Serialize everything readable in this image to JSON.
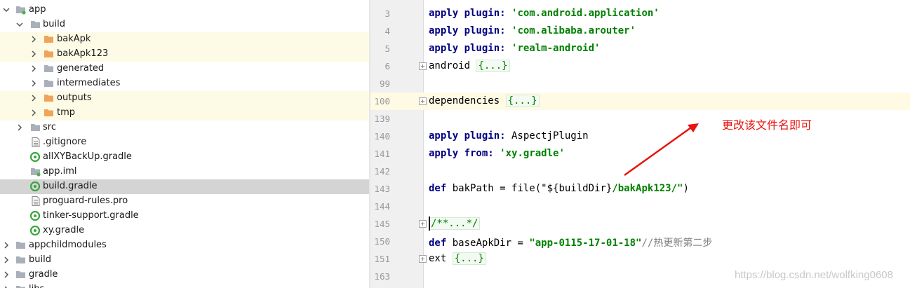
{
  "project_tree": {
    "items": [
      {
        "label": "app",
        "type": "module",
        "expanded": true
      },
      {
        "label": "build",
        "type": "folder",
        "expanded": true
      },
      {
        "label": "bakApk",
        "type": "folder-orange",
        "expanded": false
      },
      {
        "label": "bakApk123",
        "type": "folder-orange",
        "expanded": false
      },
      {
        "label": "generated",
        "type": "folder",
        "expanded": false
      },
      {
        "label": "intermediates",
        "type": "folder",
        "expanded": false
      },
      {
        "label": "outputs",
        "type": "folder-orange",
        "expanded": false
      },
      {
        "label": "tmp",
        "type": "folder-orange",
        "expanded": false
      },
      {
        "label": "src",
        "type": "folder",
        "expanded": false
      },
      {
        "label": ".gitignore",
        "type": "file"
      },
      {
        "label": "allXYBackUp.gradle",
        "type": "gradle"
      },
      {
        "label": "app.iml",
        "type": "iml"
      },
      {
        "label": "build.gradle",
        "type": "gradle",
        "selected": true
      },
      {
        "label": "proguard-rules.pro",
        "type": "file"
      },
      {
        "label": "tinker-support.gradle",
        "type": "gradle"
      },
      {
        "label": "xy.gradle",
        "type": "gradle"
      },
      {
        "label": "appchildmodules",
        "type": "folder",
        "expanded": false
      },
      {
        "label": "build",
        "type": "folder",
        "expanded": false
      },
      {
        "label": "gradle",
        "type": "folder",
        "expanded": false
      },
      {
        "label": "libs",
        "type": "folder",
        "expanded": false
      }
    ]
  },
  "editor": {
    "lines": [
      {
        "num": "3",
        "kw": "apply plugin:",
        "rest": " ",
        "str": "'com.android.application'"
      },
      {
        "num": "4",
        "kw": "apply plugin:",
        "rest": " ",
        "str": "'com.alibaba.arouter'"
      },
      {
        "num": "5",
        "kw": "apply plugin:",
        "rest": " ",
        "str": "'realm-android'"
      },
      {
        "num": "6",
        "plain": "android ",
        "folded": "{...}"
      },
      {
        "num": "99"
      },
      {
        "num": "100",
        "plain": "dependencies ",
        "folded": "{...}"
      },
      {
        "num": "139"
      },
      {
        "num": "140",
        "kw": "apply plugin:",
        "rest": " AspectjPlugin"
      },
      {
        "num": "141",
        "kw": "apply from:",
        "rest": " ",
        "str": "'xy.gradle'"
      },
      {
        "num": "142"
      },
      {
        "num": "143",
        "kw": "def",
        "rest": " bakPath = file(\"${buildDir}",
        "str": "/bakApk123/\"",
        "tail": ")"
      },
      {
        "num": "144"
      },
      {
        "num": "145",
        "folded": "/**...*/"
      },
      {
        "num": "150",
        "kw": "def",
        "rest": " baseApkDir = ",
        "str": "\"app-0115-17-01-18\"",
        "comment": "//热更新第二步"
      },
      {
        "num": "151",
        "plain": "ext ",
        "folded": "{...}"
      },
      {
        "num": "163"
      }
    ]
  },
  "annotation": {
    "text": "更改该文件名即可",
    "color": "#e8130e"
  },
  "watermark": {
    "text": "https://blog.csdn.net/wolfking0608"
  },
  "colors": {
    "keyword": "#000080",
    "string": "#008000",
    "comment": "#808080",
    "line_number": "#999999",
    "selected_row": "#d4d4d4",
    "highlight_row": "#fdfbe6"
  }
}
